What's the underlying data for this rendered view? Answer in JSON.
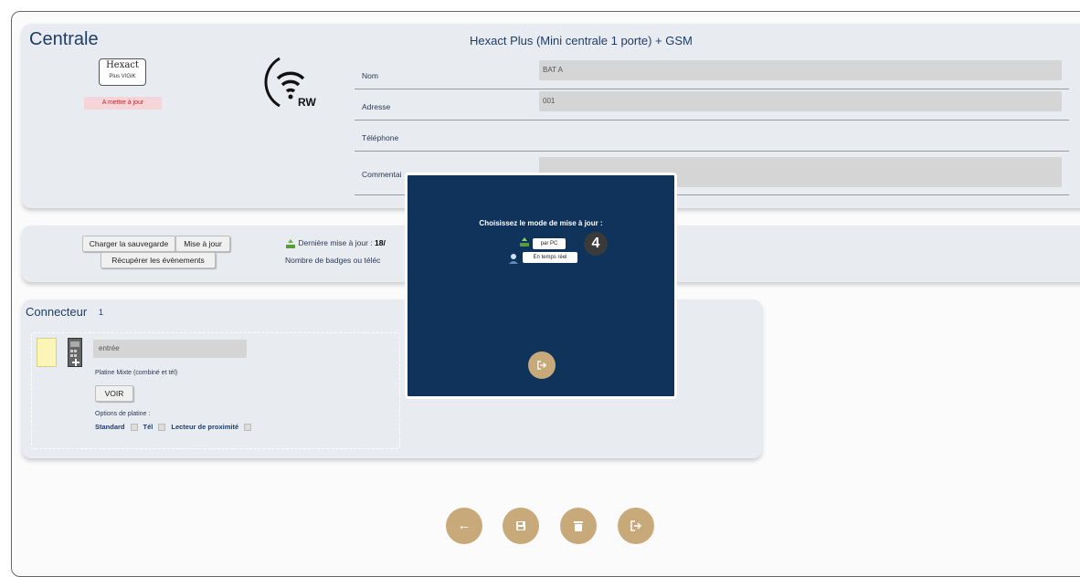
{
  "centrale": {
    "title": "Centrale",
    "device_name": "Hexact Plus (Mini centrale 1 porte) + GSM",
    "logo_line1": "Hexact",
    "logo_line2": "Plus VIGIK",
    "status": "A mettre à jour",
    "wifi_label": "RW",
    "fields": [
      {
        "label": "Nom",
        "value": "BAT A"
      },
      {
        "label": "Adresse",
        "value": "001"
      },
      {
        "label": "Téléphone",
        "value": ""
      },
      {
        "label": "Commentai",
        "value": ""
      }
    ]
  },
  "actions": {
    "load_backup": "Charger la sauvegarde",
    "update": "Mise à jour",
    "get_events": "Récupérer les évènements",
    "last_update_label": "Dernière mise à jour : ",
    "last_update_value": "18/",
    "badge_count_label": "Nombre de badges ou téléc"
  },
  "connecteur": {
    "title": "Connecteur",
    "number": "1",
    "input_value": "entrée",
    "platine_type": "Platine Mixte (combiné et tél)",
    "voir_label": "VOIR",
    "options_label": "Options de platine :",
    "options": [
      "Standard",
      "Tél",
      "Lecteur de proximité"
    ]
  },
  "modal": {
    "title": "Choisissez le mode de mise à jour :",
    "mode_pc": "par PC",
    "mode_realtime": "En temps réel",
    "step": "4"
  },
  "footer": {
    "back_icon": "arrow-left-icon",
    "save_icon": "save-icon",
    "delete_icon": "trash-icon",
    "exit_icon": "exit-icon"
  },
  "colors": {
    "accent": "#c8a979",
    "modal_bg": "#0f335a",
    "title": "#1e3d6b",
    "card": "#e8ebf0"
  }
}
